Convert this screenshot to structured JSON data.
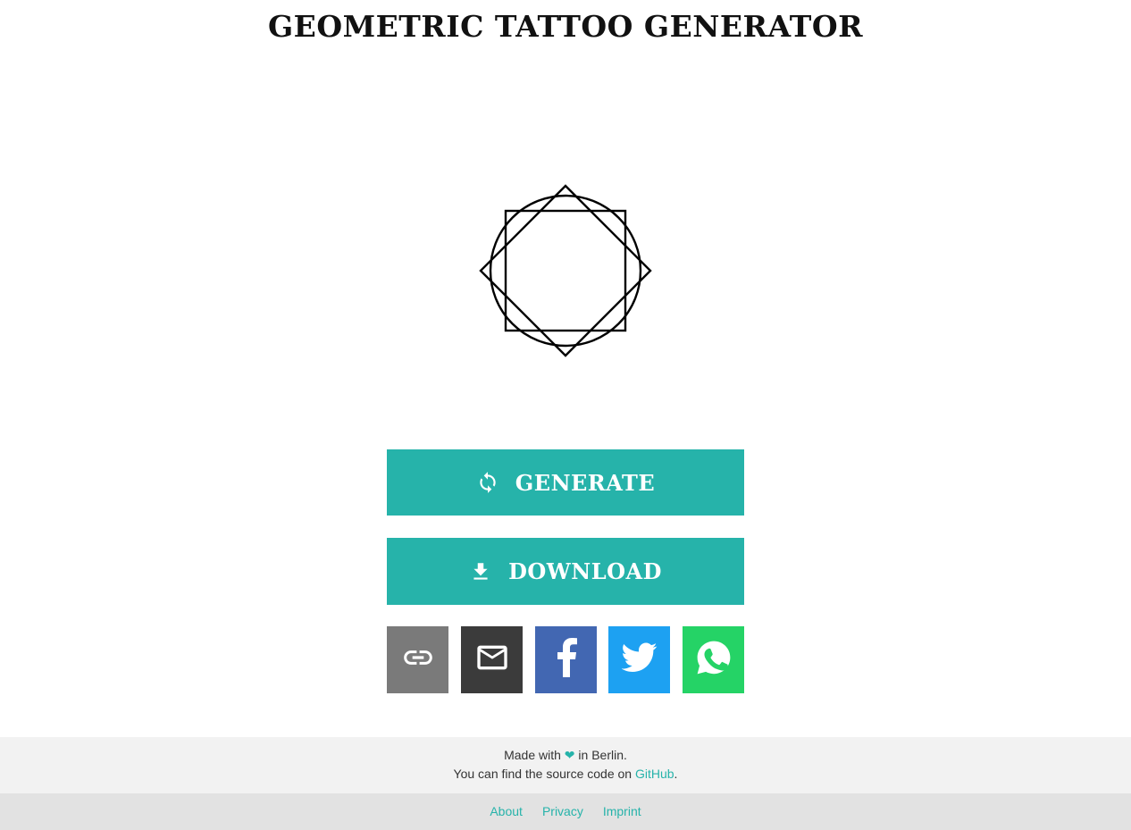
{
  "header": {
    "title": "GEOMETRIC TATTOO GENERATOR"
  },
  "tattoo": {
    "shapes": [
      "circle",
      "square",
      "diamond"
    ],
    "stroke_color": "#000000"
  },
  "actions": {
    "generate_label": "GENERATE",
    "generate_icon": "refresh-icon",
    "download_label": "DOWNLOAD",
    "download_icon": "download-icon",
    "accent_color": "#26b3aa"
  },
  "share": [
    {
      "name": "link",
      "icon": "link-icon",
      "color": "#7a7a7a"
    },
    {
      "name": "email",
      "icon": "mail-icon",
      "color": "#3b3b3b"
    },
    {
      "name": "facebook",
      "icon": "facebook-icon",
      "color": "#4267b2"
    },
    {
      "name": "twitter",
      "icon": "twitter-icon",
      "color": "#1da1f2"
    },
    {
      "name": "whatsapp",
      "icon": "whatsapp-icon",
      "color": "#25d366"
    }
  ],
  "footer": {
    "made_with_prefix": "Made with",
    "heart": "❤",
    "made_with_suffix": "in Berlin.",
    "source_prefix": "You can find the source code on",
    "source_link": "GitHub",
    "source_suffix": "."
  },
  "subfooter": {
    "about": "About",
    "privacy": "Privacy",
    "imprint": "Imprint"
  }
}
